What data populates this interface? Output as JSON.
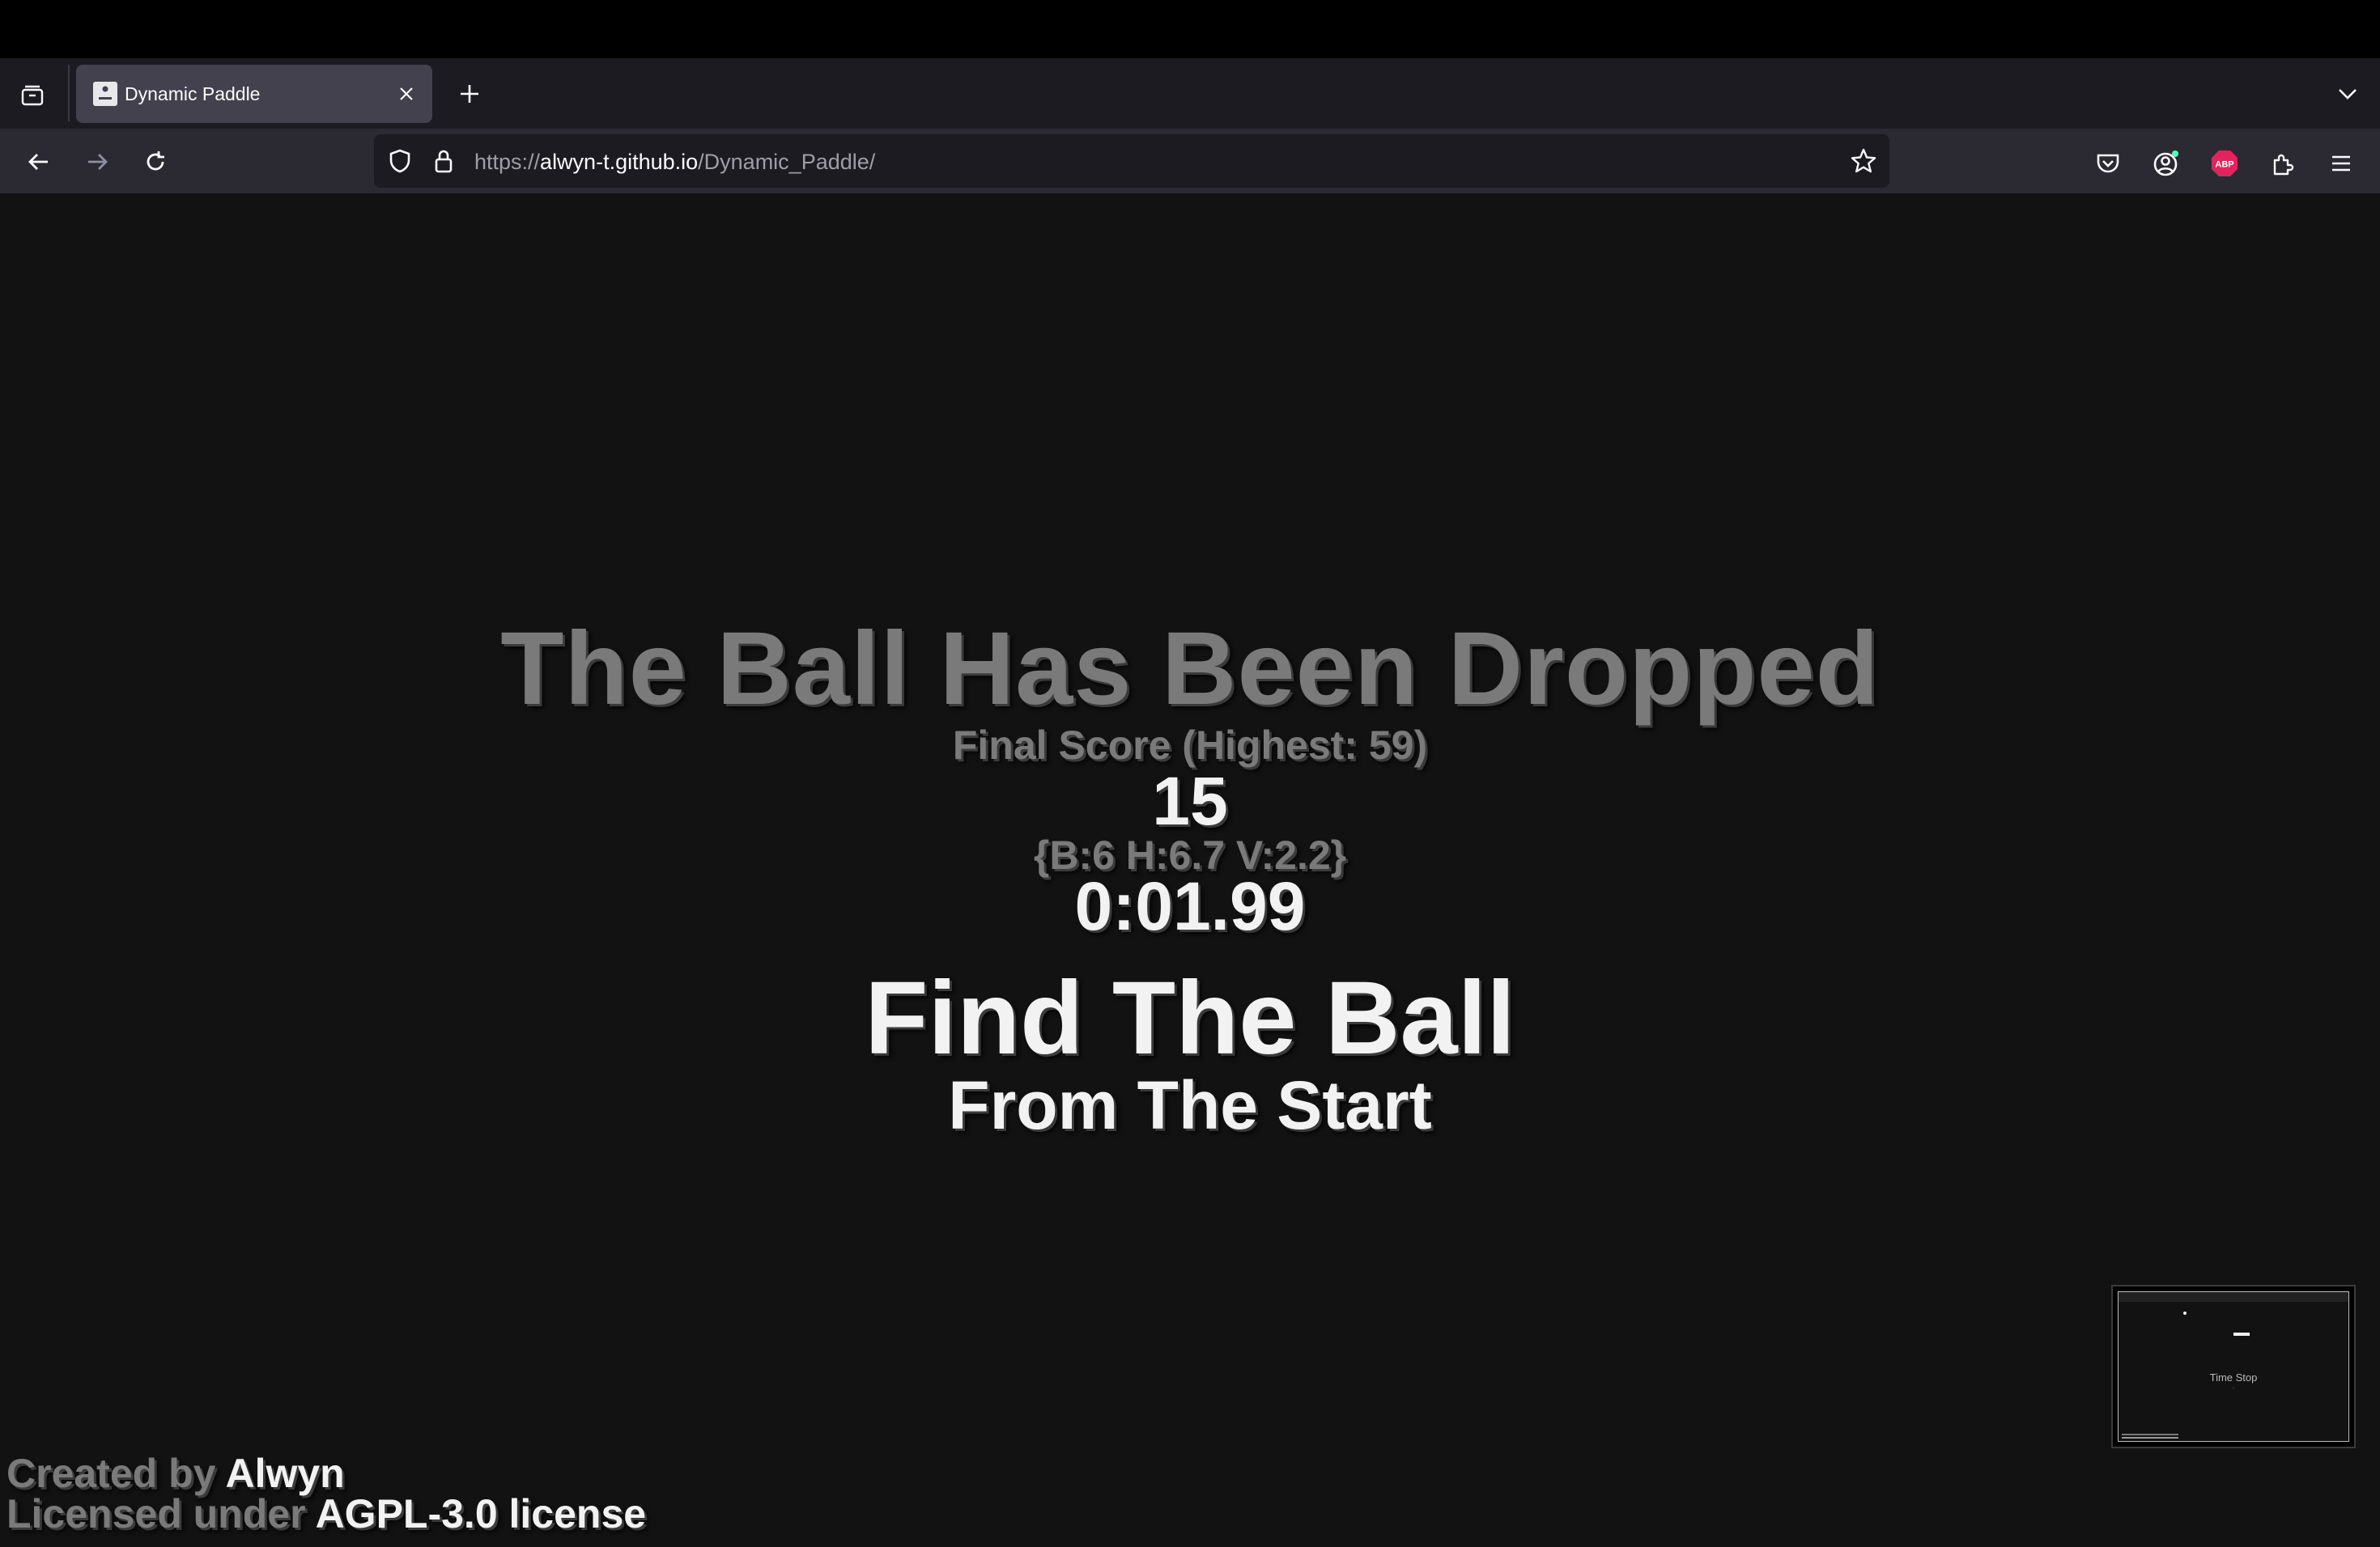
{
  "browser": {
    "tab": {
      "title": "Dynamic Paddle"
    },
    "url": {
      "scheme": "https://",
      "host": "alwyn-t.github.io",
      "path": "/Dynamic_Paddle/"
    },
    "extensions": {
      "abp_badge": "ABP"
    }
  },
  "game": {
    "game_over_title": "The Ball Has Been Dropped",
    "final_score_label": "Final Score (Highest: 59)",
    "final_score": "15",
    "stats": "{B:6 H:6.7 V:2.2}",
    "time": "0:01.99",
    "prompt_title": "Find The Ball",
    "prompt_subtitle": "From The Start"
  },
  "credits": {
    "created_prefix": "Created by",
    "author": "Alwyn",
    "license_prefix": "Licensed under",
    "license": "AGPL-3.0 license"
  },
  "pip": {
    "caption": "Time Stop"
  }
}
